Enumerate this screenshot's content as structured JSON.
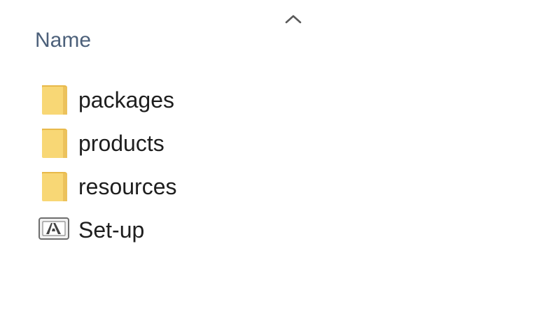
{
  "header": {
    "column_name": "Name",
    "sort_icon": "sort-ascending-chevron-icon"
  },
  "files": [
    {
      "name": "packages",
      "type": "folder",
      "icon": "folder-icon"
    },
    {
      "name": "products",
      "type": "folder",
      "icon": "folder-icon"
    },
    {
      "name": "resources",
      "type": "folder",
      "icon": "folder-icon"
    },
    {
      "name": "Set-up",
      "type": "application",
      "icon": "adobe-setup-app-icon"
    }
  ],
  "colors": {
    "folder_fill": "#F8D775",
    "folder_tab": "#E8B94A",
    "header_text": "#4C607A",
    "item_text": "#1E1E1E"
  }
}
